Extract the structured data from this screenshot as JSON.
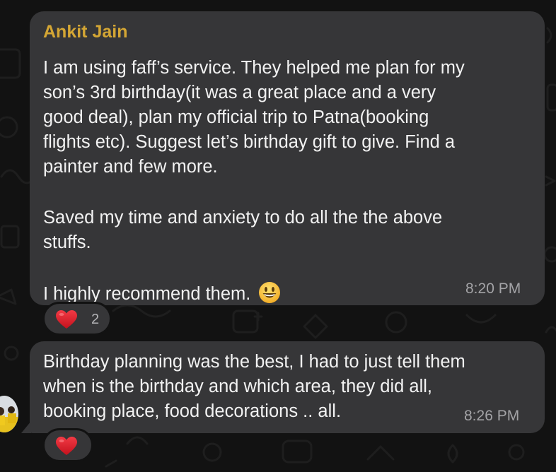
{
  "messages": [
    {
      "sender": "Ankit Jain",
      "lines": [
        "I am using faff’s service. They helped me plan for my",
        "son’s 3rd birthday(it was a great place and a very",
        "good deal), plan my official trip to Patna(booking",
        "flights etc). Suggest let’s birthday gift to give.  Find a",
        "painter and few more.",
        "Saved my time and anxiety to do all the the above",
        "stuffs.",
        "I highly recommend them."
      ],
      "emoji": "grinning-face",
      "time": "8:20 PM",
      "reaction": {
        "icon": "red-heart",
        "count": "2"
      }
    },
    {
      "lines": [
        "Birthday planning was the best, I had to just tell them",
        "when is the birthday and which area, they did all,",
        "booking place, food decorations .. all."
      ],
      "time": "8:26 PM",
      "reaction": {
        "icon": "red-heart"
      }
    }
  ],
  "colors": {
    "background": "#121212",
    "bubble": "#363638",
    "sender_name": "#d4a634",
    "message_text": "#f2f2f2",
    "timestamp": "#a3a3a6",
    "heart": "#e0242f"
  }
}
